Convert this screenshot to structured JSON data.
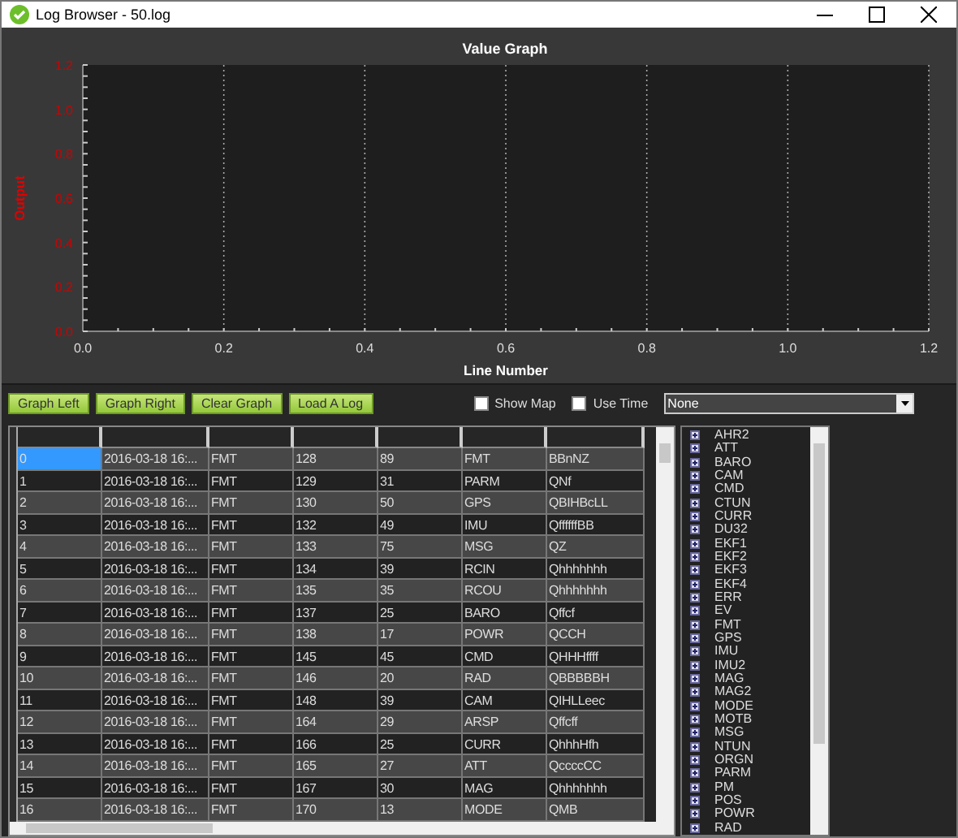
{
  "window": {
    "title": "Log Browser - 50.log"
  },
  "graph": {
    "chart_data": {
      "type": "line",
      "grid": true,
      "title": "Value Graph",
      "xlabel": "Line Number",
      "ylabel": "Output",
      "xlim": [
        0,
        1.2
      ],
      "ylim": [
        0,
        1.2
      ],
      "xticks": [
        {
          "value": 0,
          "label": "0.0"
        },
        {
          "value": 0.2,
          "label": "0.2"
        },
        {
          "value": 0.4,
          "label": "0.4"
        },
        {
          "value": 0.6,
          "label": "0.6"
        },
        {
          "value": 0.8,
          "label": "0.8"
        },
        {
          "value": 1,
          "label": "1.0"
        },
        {
          "value": 1.2,
          "label": "1.2"
        }
      ],
      "yticks": [
        {
          "value": 0,
          "label": "0.0"
        },
        {
          "value": 0.2,
          "label": "0.2"
        },
        {
          "value": 0.4,
          "label": "0.4"
        },
        {
          "value": 0.6,
          "label": "0.6"
        },
        {
          "value": 0.8,
          "label": "0.8"
        },
        {
          "value": 1,
          "label": "1.0"
        },
        {
          "value": 1.2,
          "label": "1.2"
        }
      ]
    }
  },
  "toolbar": {
    "buttons": [
      "Graph Left",
      "Graph Right",
      "Clear Graph",
      "Load A Log"
    ],
    "checkboxes": [
      {
        "label": "Show Map",
        "checked": false
      },
      {
        "label": "Use Time",
        "checked": false
      }
    ],
    "dropdown": {
      "value": "None"
    }
  },
  "table": {
    "rows": [
      {
        "cells": [
          "0",
          "2016-03-18 16:...",
          "FMT",
          "128",
          "89",
          "FMT",
          "BBnNZ"
        ],
        "selected": true
      },
      {
        "cells": [
          "1",
          "2016-03-18 16:...",
          "FMT",
          "129",
          "31",
          "PARM",
          "QNf"
        ],
        "selected": false
      },
      {
        "cells": [
          "2",
          "2016-03-18 16:...",
          "FMT",
          "130",
          "50",
          "GPS",
          "QBIHBcLL"
        ],
        "selected": false
      },
      {
        "cells": [
          "3",
          "2016-03-18 16:...",
          "FMT",
          "132",
          "49",
          "IMU",
          "QffffffBB"
        ],
        "selected": false
      },
      {
        "cells": [
          "4",
          "2016-03-18 16:...",
          "FMT",
          "133",
          "75",
          "MSG",
          "QZ"
        ],
        "selected": false
      },
      {
        "cells": [
          "5",
          "2016-03-18 16:...",
          "FMT",
          "134",
          "39",
          "RCIN",
          "Qhhhhhhh"
        ],
        "selected": false
      },
      {
        "cells": [
          "6",
          "2016-03-18 16:...",
          "FMT",
          "135",
          "35",
          "RCOU",
          "Qhhhhhhh"
        ],
        "selected": false
      },
      {
        "cells": [
          "7",
          "2016-03-18 16:...",
          "FMT",
          "137",
          "25",
          "BARO",
          "Qffcf"
        ],
        "selected": false
      },
      {
        "cells": [
          "8",
          "2016-03-18 16:...",
          "FMT",
          "138",
          "17",
          "POWR",
          "QCCH"
        ],
        "selected": false
      },
      {
        "cells": [
          "9",
          "2016-03-18 16:...",
          "FMT",
          "145",
          "45",
          "CMD",
          "QHHHffff"
        ],
        "selected": false
      },
      {
        "cells": [
          "10",
          "2016-03-18 16:...",
          "FMT",
          "146",
          "20",
          "RAD",
          "QBBBBBH"
        ],
        "selected": false
      },
      {
        "cells": [
          "11",
          "2016-03-18 16:...",
          "FMT",
          "148",
          "39",
          "CAM",
          "QIHLLeec"
        ],
        "selected": false
      },
      {
        "cells": [
          "12",
          "2016-03-18 16:...",
          "FMT",
          "164",
          "29",
          "ARSP",
          "Qffcff"
        ],
        "selected": false
      },
      {
        "cells": [
          "13",
          "2016-03-18 16:...",
          "FMT",
          "166",
          "25",
          "CURR",
          "QhhhHfh"
        ],
        "selected": false
      },
      {
        "cells": [
          "14",
          "2016-03-18 16:...",
          "FMT",
          "165",
          "27",
          "ATT",
          "QccccCC"
        ],
        "selected": false
      },
      {
        "cells": [
          "15",
          "2016-03-18 16:...",
          "FMT",
          "167",
          "30",
          "MAG",
          "Qhhhhhhh"
        ],
        "selected": false
      },
      {
        "cells": [
          "16",
          "2016-03-18 16:...",
          "FMT",
          "170",
          "13",
          "MODE",
          "QMB"
        ],
        "selected": false
      }
    ]
  },
  "message_tree": {
    "items": [
      {
        "label": "AHR2",
        "expanded": false
      },
      {
        "label": "ATT",
        "expanded": false
      },
      {
        "label": "BARO",
        "expanded": false
      },
      {
        "label": "CAM",
        "expanded": false
      },
      {
        "label": "CMD",
        "expanded": false
      },
      {
        "label": "CTUN",
        "expanded": false
      },
      {
        "label": "CURR",
        "expanded": false
      },
      {
        "label": "DU32",
        "expanded": false
      },
      {
        "label": "EKF1",
        "expanded": false
      },
      {
        "label": "EKF2",
        "expanded": false
      },
      {
        "label": "EKF3",
        "expanded": false
      },
      {
        "label": "EKF4",
        "expanded": false
      },
      {
        "label": "ERR",
        "expanded": false
      },
      {
        "label": "EV",
        "expanded": false
      },
      {
        "label": "FMT",
        "expanded": false
      },
      {
        "label": "GPS",
        "expanded": false
      },
      {
        "label": "IMU",
        "expanded": false
      },
      {
        "label": "IMU2",
        "expanded": false
      },
      {
        "label": "MAG",
        "expanded": false
      },
      {
        "label": "MAG2",
        "expanded": false
      },
      {
        "label": "MODE",
        "expanded": false
      },
      {
        "label": "MOTB",
        "expanded": false
      },
      {
        "label": "MSG",
        "expanded": false
      },
      {
        "label": "NTUN",
        "expanded": false
      },
      {
        "label": "ORGN",
        "expanded": false
      },
      {
        "label": "PARM",
        "expanded": false
      },
      {
        "label": "PM",
        "expanded": false
      },
      {
        "label": "POS",
        "expanded": false
      },
      {
        "label": "POWR",
        "expanded": false
      },
      {
        "label": "RAD",
        "expanded": false
      }
    ]
  }
}
